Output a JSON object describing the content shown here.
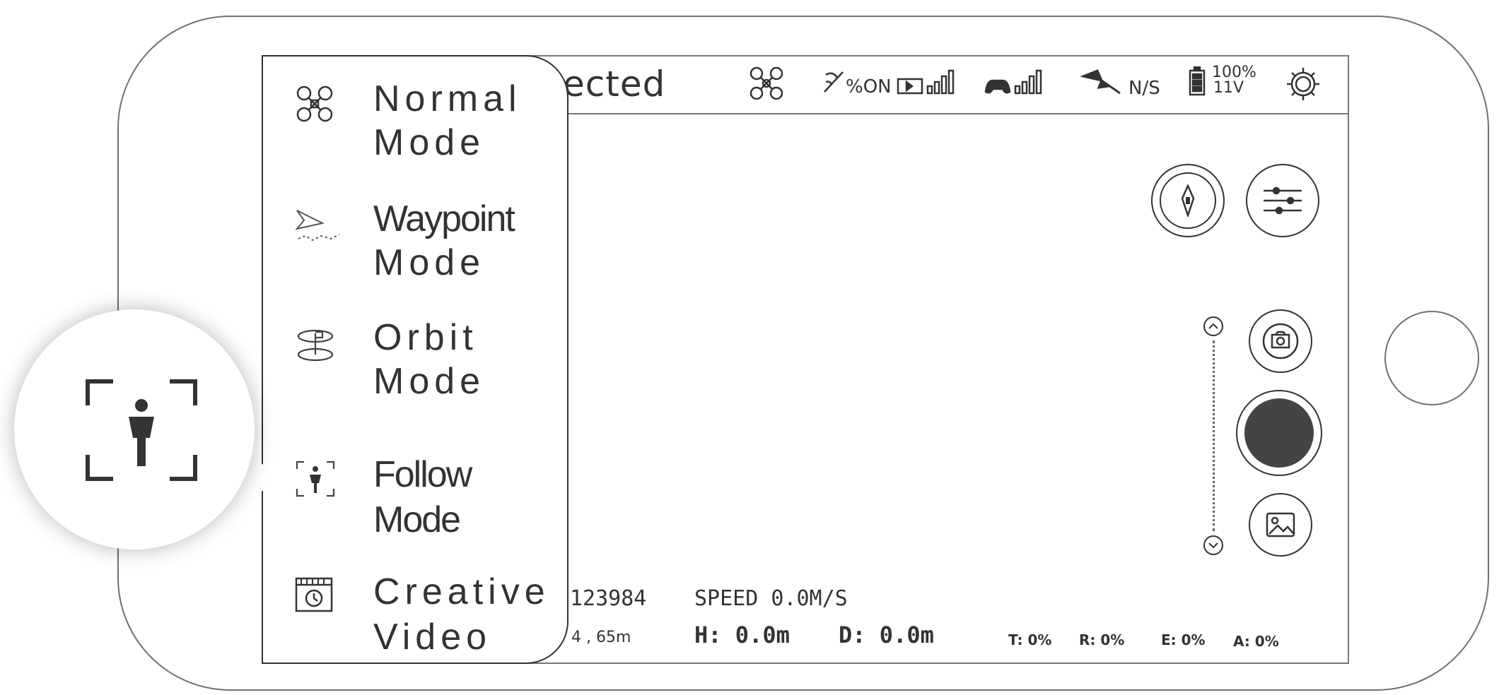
{
  "status_bar": {
    "connection_text": "ected",
    "gps_signal": "%ON",
    "gps_status": "N/S",
    "battery_percent": "100%",
    "battery_voltage": "11V"
  },
  "menu": {
    "items": [
      {
        "line1": "Normal",
        "line2": "Mode",
        "icon": "drone-icon"
      },
      {
        "line1": "Waypoint",
        "line2": "Mode",
        "icon": "waypoint-icon"
      },
      {
        "line1": "Orbit",
        "line2": "Mode",
        "icon": "orbit-icon"
      },
      {
        "line1": "Follow",
        "line2": "Mode",
        "icon": "follow-icon"
      },
      {
        "line1": "Creative",
        "line2": "Video",
        "icon": "creative-video-icon"
      }
    ]
  },
  "telemetry": {
    "id_fragment": "123984",
    "speed": "SPEED 0.0M/S",
    "coord_fragment": "4 , 65m",
    "height": "H: 0.0m",
    "distance": "D: 0.0m",
    "t": "T: 0%",
    "r": "R: 0%",
    "e": "E: 0%",
    "a": "A: 0%"
  },
  "colors": {
    "outline": "#333333",
    "record": "#444444",
    "frame": "#777777"
  }
}
